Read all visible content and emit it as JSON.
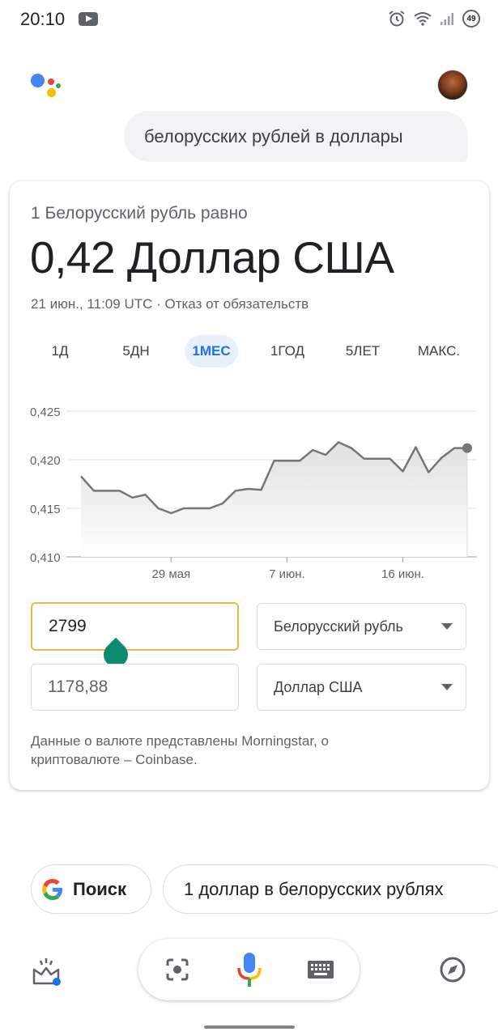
{
  "status_bar": {
    "time": "20:10",
    "battery_level": "49",
    "icons": [
      "youtube-icon",
      "alarm-icon",
      "wifi-icon",
      "signal-icon",
      "battery-icon"
    ]
  },
  "query": {
    "text": "белорусских рублей в доллары"
  },
  "card": {
    "subtitle": "1 Белорусский рубль равно",
    "rate": "0,42 Доллар США",
    "timestamp": "21 июн., 11:09 UTC · Отказ от обязательств",
    "tabs": [
      {
        "label": "1Д",
        "active": false
      },
      {
        "label": "5ДН",
        "active": false
      },
      {
        "label": "1МЕС",
        "active": true
      },
      {
        "label": "1ГОД",
        "active": false
      },
      {
        "label": "5ЛЕТ",
        "active": false
      },
      {
        "label": "МАКС.",
        "active": false
      }
    ],
    "converter": {
      "amount_value": "2799",
      "from_currency": "Белорусский рубль",
      "result_value": "1178,88",
      "to_currency": "Доллар США"
    },
    "disclaimer": "Данные о валюте представлены Morningstar, о криптовалюте – Coinbase."
  },
  "chart_data": {
    "type": "area",
    "title": "",
    "xlabel": "",
    "ylabel": "",
    "ylim": [
      0.41,
      0.425
    ],
    "y_ticks": [
      "0,425",
      "0,420",
      "0,415",
      "0,410"
    ],
    "x_ticks": [
      "29 мая",
      "7 июн.",
      "16 июн."
    ],
    "grid": true,
    "color": "#757575",
    "fill_color": "#e0e0e0",
    "series": [
      {
        "values": [
          0.4183,
          0.4168,
          0.4168,
          0.4168,
          0.4161,
          0.4164,
          0.415,
          0.4145,
          0.415,
          0.415,
          0.415,
          0.4155,
          0.4168,
          0.417,
          0.4169,
          0.4199,
          0.4199,
          0.4199,
          0.421,
          0.4205,
          0.4218,
          0.4212,
          0.4201,
          0.4201,
          0.4201,
          0.4188,
          0.4213,
          0.4187,
          0.4202,
          0.4212,
          0.4212
        ]
      }
    ]
  },
  "suggestions": [
    {
      "label": "Поиск"
    },
    {
      "label": "1 доллар в белорусских рублях"
    }
  ],
  "bottom_bar": {
    "icons": [
      "updates-icon",
      "lens-icon",
      "mic-icon",
      "keyboard-icon",
      "explore-icon"
    ]
  },
  "colors": {
    "google_blue": "#4285F4",
    "google_red": "#EA4335",
    "google_yellow": "#FBBC05",
    "google_green": "#34A853",
    "active_tab": "#1a73e8",
    "focus_border": "#e8b84a",
    "cursor_drop": "#0e8a6e"
  }
}
